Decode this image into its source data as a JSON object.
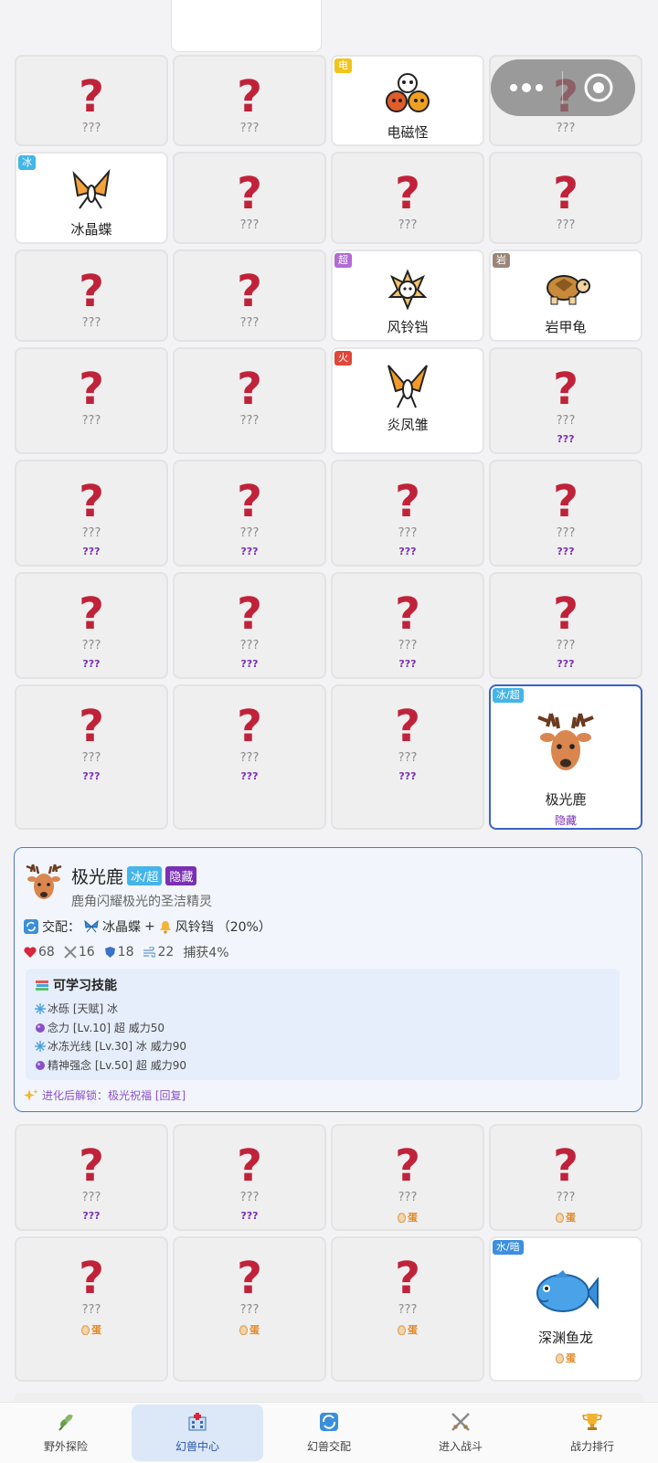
{
  "unknown_mark": "?",
  "unknown_label": "???",
  "hidden_label": "???",
  "egg_label": "蛋",
  "rows": [
    {
      "cells": [
        {
          "state": "unknown"
        },
        {
          "state": "unknown"
        },
        {
          "state": "known",
          "name": "电磁怪",
          "badge": "电",
          "badge_color": "#f0c419",
          "icon": "magnet-cluster-icon"
        },
        {
          "state": "unknown"
        }
      ]
    },
    {
      "cells": [
        {
          "state": "known",
          "name": "冰晶蝶",
          "badge": "冰",
          "badge_color": "#43b5e8",
          "icon": "butterfly-icon"
        },
        {
          "state": "unknown"
        },
        {
          "state": "unknown"
        },
        {
          "state": "unknown"
        }
      ]
    },
    {
      "cells": [
        {
          "state": "unknown"
        },
        {
          "state": "unknown"
        },
        {
          "state": "known",
          "name": "风铃铛",
          "badge": "超",
          "badge_color": "#b26bd6",
          "icon": "bell-creature-icon"
        },
        {
          "state": "known",
          "name": "岩甲龟",
          "badge": "岩",
          "badge_color": "#9b8578",
          "icon": "turtle-icon"
        }
      ]
    },
    {
      "cells": [
        {
          "state": "unknown"
        },
        {
          "state": "unknown"
        },
        {
          "state": "known",
          "name": "炎凤雏",
          "badge": "火",
          "badge_color": "#e0463a",
          "icon": "phoenix-icon"
        },
        {
          "state": "unknown",
          "sub": "hidden"
        }
      ]
    },
    {
      "cells": [
        {
          "state": "unknown",
          "sub": "hidden"
        },
        {
          "state": "unknown",
          "sub": "hidden"
        },
        {
          "state": "unknown",
          "sub": "hidden"
        },
        {
          "state": "unknown",
          "sub": "hidden"
        }
      ]
    },
    {
      "cells": [
        {
          "state": "unknown",
          "sub": "hidden"
        },
        {
          "state": "unknown",
          "sub": "hidden"
        },
        {
          "state": "unknown",
          "sub": "hidden"
        },
        {
          "state": "unknown",
          "sub": "hidden"
        }
      ]
    },
    {
      "cells": [
        {
          "state": "unknown",
          "sub": "hidden"
        },
        {
          "state": "unknown",
          "sub": "hidden"
        },
        {
          "state": "unknown",
          "sub": "hidden"
        },
        {
          "state": "selected",
          "name": "极光鹿",
          "badge": "冰/超",
          "badge_color": "#43b5e8",
          "icon": "deer-icon",
          "sub_text": "隐藏"
        }
      ]
    }
  ],
  "rows_bottom": [
    {
      "cells": [
        {
          "state": "unknown",
          "sub": "hidden"
        },
        {
          "state": "unknown",
          "sub": "hidden"
        },
        {
          "state": "unknown",
          "sub": "egg"
        },
        {
          "state": "unknown",
          "sub": "egg"
        }
      ]
    },
    {
      "cells": [
        {
          "state": "unknown",
          "sub": "egg"
        },
        {
          "state": "unknown",
          "sub": "egg"
        },
        {
          "state": "unknown",
          "sub": "egg"
        },
        {
          "state": "known",
          "name": "深渊鱼龙",
          "badge": "水/暗",
          "badge_color": "#3c8fe0",
          "icon": "fish-icon",
          "sub": "egg"
        }
      ]
    }
  ],
  "detail": {
    "name": "极光鹿",
    "type_tag": "冰/超",
    "rarity_tag": "隐藏",
    "description": "鹿角闪耀极光的圣洁精灵",
    "breed_label": "交配：",
    "parent1": "冰晶蝶",
    "plus": "+",
    "parent2": "风铃铛",
    "chance": "（20%）",
    "hp": "68",
    "atk": "16",
    "def": "18",
    "spd": "22",
    "catch": "捕获4%",
    "skills_title": "可学习技能",
    "skills": [
      "冰砾 [天赋] 冰",
      "念力 [Lv.10] 超 威力50",
      "冰冻光线 [Lv.30] 冰 威力90",
      "精神强念 [Lv.50] 超 威力90"
    ],
    "skill_icons": [
      "snowflake",
      "orb",
      "snowflake",
      "orb"
    ],
    "evolution_unlock": "进化后解锁：极光祝福 [回复]"
  },
  "nav": [
    {
      "label": "野外探险",
      "icon": "herb-icon"
    },
    {
      "label": "幻兽中心",
      "icon": "hospital-icon",
      "active": true
    },
    {
      "label": "幻兽交配",
      "icon": "cycle-icon"
    },
    {
      "label": "进入战斗",
      "icon": "crossed-swords-icon"
    },
    {
      "label": "战力排行",
      "icon": "trophy-icon"
    }
  ],
  "colors": {
    "accent": "#3a63c8",
    "unknown_mark": "#c0223a",
    "hidden": "#7a2fb5",
    "egg": "#e08a2a"
  }
}
